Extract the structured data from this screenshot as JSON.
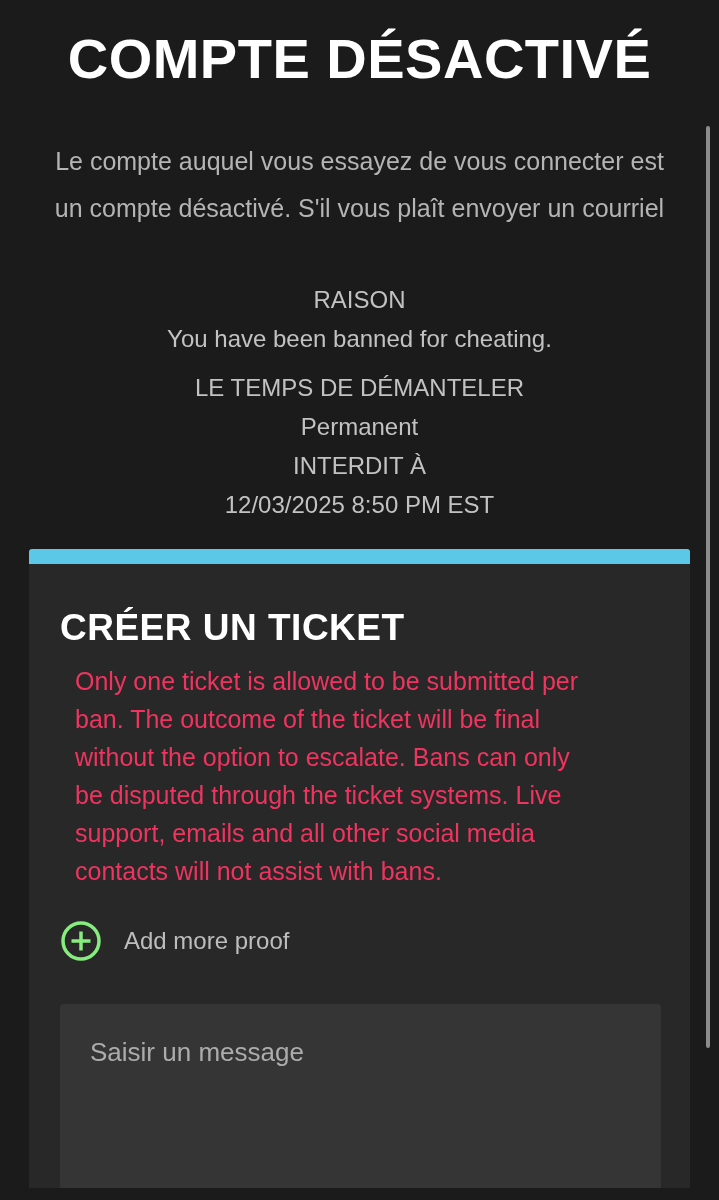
{
  "page": {
    "title": "COMPTE DÉSACTIVÉ",
    "message": "Le compte auquel vous essayez de vous connecter est un compte désactivé. S'il vous plaît envoyer un courriel"
  },
  "ban_details": [
    {
      "label": "RAISON",
      "value": "You have been banned for cheating."
    },
    {
      "label": "LE TEMPS DE DÉMANTELER",
      "value": "Permanent"
    },
    {
      "label": "INTERDIT À",
      "value": "12/03/2025 8:50 PM EST"
    }
  ],
  "ticket": {
    "title": "CRÉER UN TICKET",
    "warning": "Only one ticket is allowed to be submitted per ban. The outcome of the ticket will be final without the option to escalate. Bans can only be disputed through the ticket systems. Live support, emails and all other social media contacts will not assist with bans.",
    "add_proof": "Add more proof",
    "message_field": {
      "placeholder": "Saisir un message"
    }
  }
}
